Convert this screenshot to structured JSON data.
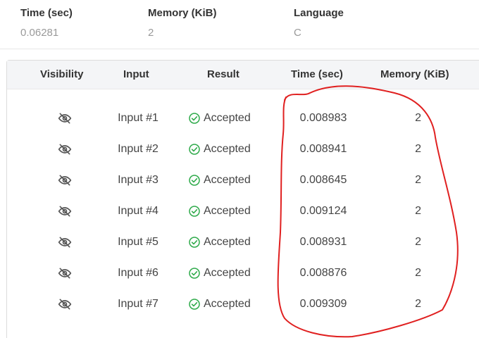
{
  "summary": {
    "time": {
      "label": "Time (sec)",
      "value": "0.06281"
    },
    "memory": {
      "label": "Memory (KiB)",
      "value": "2"
    },
    "language": {
      "label": "Language",
      "value": "C"
    }
  },
  "table": {
    "headers": {
      "visibility": "Visibility",
      "input": "Input",
      "result": "Result",
      "time": "Time (sec)",
      "memory": "Memory (KiB)"
    },
    "rows": [
      {
        "visibility_icon": "eye-slash-icon",
        "input": "Input #1",
        "result": "Accepted",
        "time": "0.008983",
        "memory": "2"
      },
      {
        "visibility_icon": "eye-slash-icon",
        "input": "Input #2",
        "result": "Accepted",
        "time": "0.008941",
        "memory": "2"
      },
      {
        "visibility_icon": "eye-slash-icon",
        "input": "Input #3",
        "result": "Accepted",
        "time": "0.008645",
        "memory": "2"
      },
      {
        "visibility_icon": "eye-slash-icon",
        "input": "Input #4",
        "result": "Accepted",
        "time": "0.009124",
        "memory": "2"
      },
      {
        "visibility_icon": "eye-slash-icon",
        "input": "Input #5",
        "result": "Accepted",
        "time": "0.008931",
        "memory": "2"
      },
      {
        "visibility_icon": "eye-slash-icon",
        "input": "Input #6",
        "result": "Accepted",
        "time": "0.008876",
        "memory": "2"
      },
      {
        "visibility_icon": "eye-slash-icon",
        "input": "Input #7",
        "result": "Accepted",
        "time": "0.009309",
        "memory": "2"
      }
    ]
  },
  "colors": {
    "accepted": "#2eaa4a",
    "annotation": "#e02020"
  }
}
